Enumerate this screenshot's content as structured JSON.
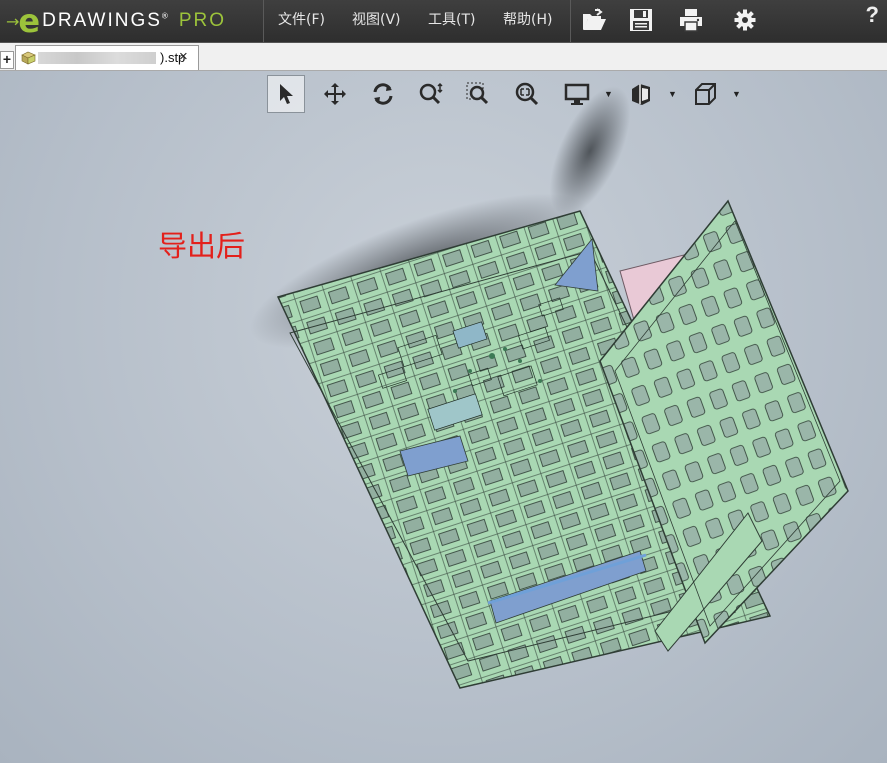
{
  "app": {
    "logo_arrow": "→",
    "logo_e": "e",
    "logo_name": "DRAWINGS",
    "logo_reg": "®",
    "logo_edition": "PRO"
  },
  "menu": [
    {
      "label": "文件(F)"
    },
    {
      "label": "视图(V)"
    },
    {
      "label": "工具(T)"
    },
    {
      "label": "帮助(H)"
    }
  ],
  "toolbar_icons": [
    "open-file-icon",
    "save-icon",
    "print-icon",
    "settings-gear-icon"
  ],
  "help_label": "?",
  "tab": {
    "new_tab_label": "+",
    "file_ext_label": ").stp",
    "close_label": "×"
  },
  "view_tools": [
    "select-arrow-icon",
    "pan-icon",
    "rotate-icon",
    "zoom-icon",
    "zoom-to-area-icon",
    "zoom-to-fit-icon",
    "display-monitor-icon",
    "section-view-icon",
    "view-orientation-cube-icon"
  ],
  "annotation": "导出后",
  "colors": {
    "accent": "#9cc33b",
    "annotation": "#e3201b",
    "model_frame": "#a9d8b3",
    "model_panel": "#7f9fcf"
  }
}
